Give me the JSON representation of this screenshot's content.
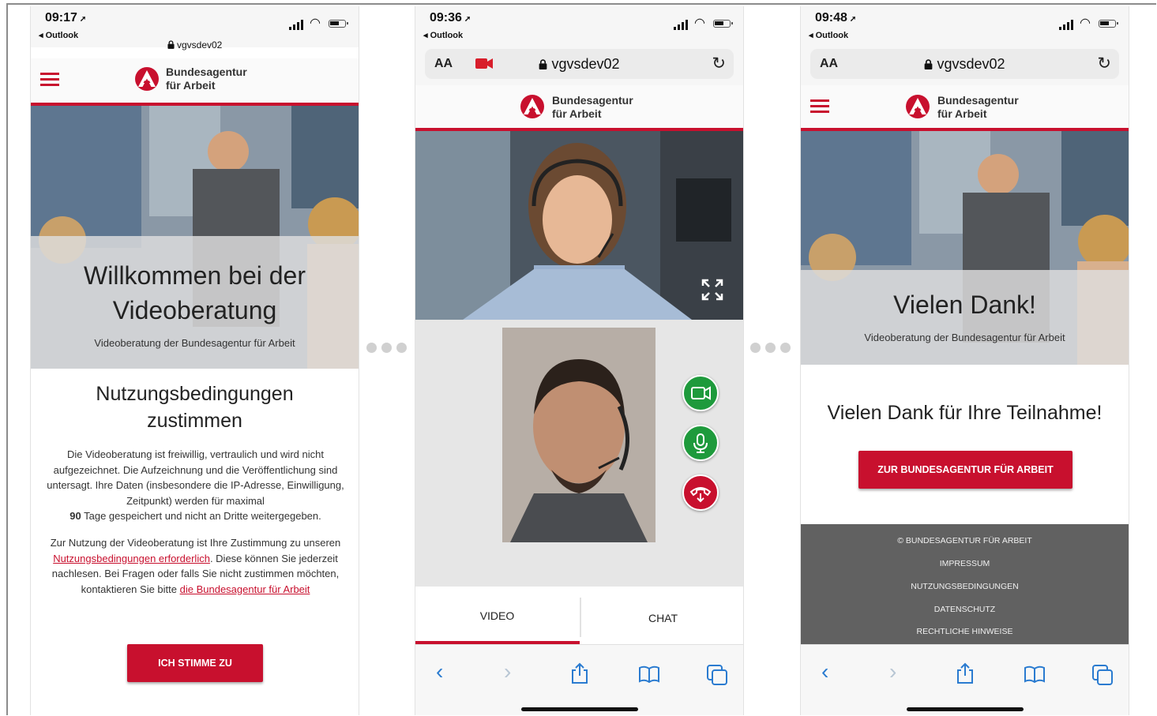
{
  "phones": [
    {
      "time": "09:17",
      "back_app": "◂ Outlook",
      "url": "vgvsdev02",
      "logo_line1": "Bundesagentur",
      "logo_line2": "für Arbeit",
      "hero_title_line1": "Willkommen bei der",
      "hero_title_line2": "Videoberatung",
      "hero_subtitle": "Videoberatung der Bundesagentur für Arbeit",
      "section_title_line1": "Nutzungsbedingungen",
      "section_title_line2": "zustimmen",
      "paragraph1": "Die Videoberatung ist freiwillig, vertraulich und wird nicht aufgezeichnet. Die Aufzeichnung und die Veröffentlichung sind untersagt. Ihre Daten (insbesondere die IP-Adresse, Einwilligung, Zeitpunkt) werden für maximal",
      "paragraph1_bold": "90",
      "paragraph1_end": "Tage gespeichert und nicht an Dritte weitergegeben.",
      "paragraph2_a": "Zur Nutzung der Videoberatung ist Ihre Zustimmung zu unseren",
      "terms_link": "Nutzungsbedingungen erforderlich",
      "paragraph2_b": ". Diese können Sie jederzeit nachlesen. Bei Fragen oder falls Sie nicht zustimmen möchten, kontaktieren Sie bitte",
      "agency_link": "die Bundesagentur für Arbeit",
      "agree_button": "ICH STIMME ZU"
    },
    {
      "time": "09:36",
      "back_app": "◂ Outlook",
      "url": "vgvsdev02",
      "text_size_label": "AA",
      "logo_line1": "Bundesagentur",
      "logo_line2": "für Arbeit",
      "tab_video": "VIDEO",
      "tab_chat": "CHAT"
    },
    {
      "time": "09:48",
      "back_app": "◂ Outlook",
      "url": "vgvsdev02",
      "text_size_label": "AA",
      "logo_line1": "Bundesagentur",
      "logo_line2": "für Arbeit",
      "hero_title": "Vielen Dank!",
      "hero_subtitle": "Videoberatung der Bundesagentur für Arbeit",
      "thanks_message": "Vielen Dank für Ihre Teilnahme!",
      "cta_button": "ZUR BUNDESAGENTUR FÜR ARBEIT",
      "footer": {
        "copyright": "© BUNDESAGENTUR FÜR ARBEIT",
        "imprint": "IMPRESSUM",
        "terms": "NUTZUNGSBEDINGUNGEN",
        "privacy": "DATENSCHUTZ",
        "legal": "RECHTLICHE HINWEISE"
      }
    }
  ],
  "colors": {
    "brand_red": "#c8102e",
    "call_green": "#1e9a3c",
    "footer_gray": "#616161",
    "safari_blue": "#2a7bd0"
  },
  "icons": [
    "hamburger-menu-icon",
    "ba-logo-icon",
    "lock-icon",
    "reload-icon",
    "camera-recording-icon",
    "fullscreen-icon",
    "video-camera-icon",
    "microphone-icon",
    "hang-up-icon",
    "back-icon",
    "forward-icon",
    "share-icon",
    "bookmarks-icon",
    "tabs-icon"
  ]
}
